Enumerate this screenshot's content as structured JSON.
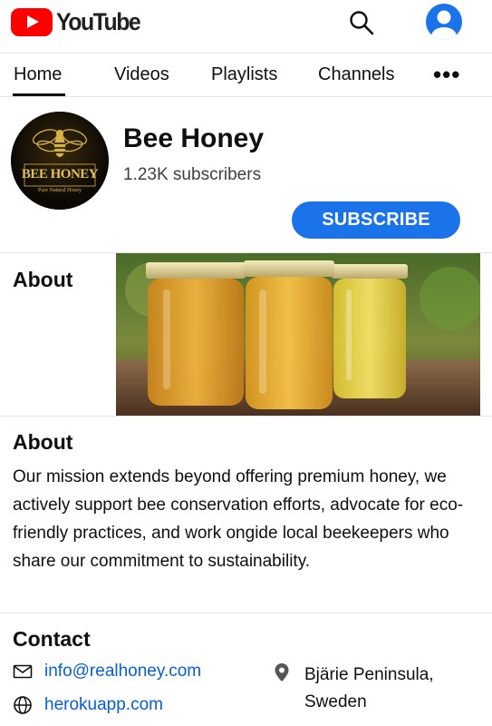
{
  "header": {
    "logo_text": "YouTube",
    "search_icon": "search-icon",
    "account_icon": "account-icon"
  },
  "tabs": [
    {
      "label": "Home",
      "active": true
    },
    {
      "label": "Videos",
      "active": false
    },
    {
      "label": "Playlists",
      "active": false
    },
    {
      "label": "Channels",
      "active": false
    }
  ],
  "more_label": "•••",
  "channel": {
    "name": "Bee Honey",
    "subscribers": "1.23K subscribers",
    "subscribe_label": "SUBSCRIBE",
    "avatar_logo_text": "BEE HONEY",
    "avatar_small_text": "Pure Natural Honey"
  },
  "about_row": {
    "label": "About"
  },
  "about": {
    "title": "About",
    "text": "Our mission extends beyond offering premium honey, we actively support bee conservation efforts, advocate for eco-friendly practices, and work ongide local beekeepers who share our commitment to sustainability."
  },
  "contact": {
    "title": "Contact",
    "email": "info@realhoney.com",
    "website": "herokuapp.com",
    "location": "Bjärie Peninsula, Sweden"
  },
  "colors": {
    "accent": "#1a73e8",
    "link": "#065fd4",
    "brand_red": "#ff0000"
  }
}
